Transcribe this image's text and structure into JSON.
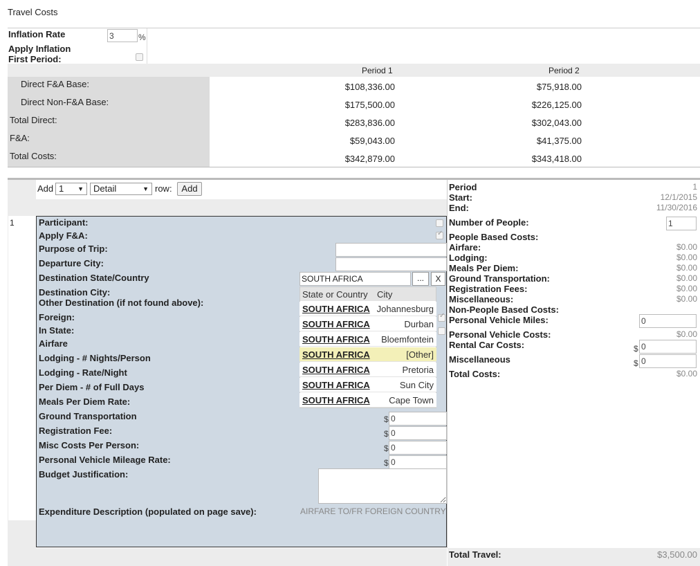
{
  "page_title": "Travel Costs",
  "inflation": {
    "rate_label": "Inflation Rate",
    "rate_value": "3",
    "percent": "%",
    "apply_label_line1": "Apply Inflation",
    "apply_label_line2": "First Period:"
  },
  "summary": {
    "period_headers": [
      "Period 1",
      "Period 2"
    ],
    "rows": [
      {
        "label": "Direct F&A Base:",
        "p1": "$108,336.00",
        "p2": "$75,918.00"
      },
      {
        "label": "Direct Non-F&A Base:",
        "p1": "$175,500.00",
        "p2": "$226,125.00"
      },
      {
        "label": "Total Direct:",
        "p1": "$283,836.00",
        "p2": "$302,043.00"
      },
      {
        "label": "F&A:",
        "p1": "$59,043.00",
        "p2": "$41,375.00"
      },
      {
        "label": "Total Costs:",
        "p1": "$342,879.00",
        "p2": "$343,418.00"
      }
    ]
  },
  "add_bar": {
    "add_label": "Add",
    "count_value": "1",
    "type_value": "Detail",
    "row_label": "row:",
    "add_button": "Add"
  },
  "row_number": "1",
  "form": {
    "participant": "Participant:",
    "apply_fa": "Apply F&A:",
    "purpose": "Purpose of Trip:",
    "departure_city": "Departure City:",
    "dest_state": "Destination State/Country",
    "dest_city": "Destination City:",
    "other_dest": "Other Destination (if not found above):",
    "foreign": "Foreign:",
    "in_state": "In State:",
    "airfare": "Airfare",
    "lodging_nights": "Lodging - # Nights/Person",
    "lodging_rate": "Lodging - Rate/Night",
    "per_diem_days": "Per Diem - # of Full Days",
    "meals_rate": "Meals Per Diem Rate:",
    "ground": "Ground Transportation",
    "registration": "Registration Fee:",
    "misc": "Misc Costs Per Person:",
    "mileage_rate": "Personal Vehicle Mileage Rate:",
    "justification": "Budget Justification:",
    "expenditure_label": "Expenditure Description (populated on page save):",
    "expenditure_value": "AIRFARE TO/FR FOREIGN COUNTRY",
    "dest_value": "SOUTH AFRICA",
    "lookup_button": "...",
    "clear_button": "X",
    "ground_value": "0",
    "registration_value": "0",
    "misc_value": "0",
    "mileage_value": "0",
    "dollar": "$"
  },
  "dropdown": {
    "headers": [
      "State or Country",
      "City"
    ],
    "rows": [
      {
        "country": "SOUTH AFRICA",
        "city": "Johannesburg"
      },
      {
        "country": "SOUTH AFRICA",
        "city": "Durban"
      },
      {
        "country": "SOUTH AFRICA",
        "city": "Bloemfontein"
      },
      {
        "country": "SOUTH AFRICA",
        "city": "[Other]",
        "highlighted": true
      },
      {
        "country": "SOUTH AFRICA",
        "city": "Pretoria"
      },
      {
        "country": "SOUTH AFRICA",
        "city": "Sun City"
      },
      {
        "country": "SOUTH AFRICA",
        "city": "Cape Town"
      }
    ],
    "highlight_color": "#f3f0b8"
  },
  "right_panel": {
    "period_label": "Period",
    "period_value": "1",
    "start_label": "Start:",
    "start_value": "12/1/2015",
    "end_label": "End:",
    "end_value": "11/30/2016",
    "num_people_label": "Number of People:",
    "num_people_value": "1",
    "people_costs_label": "People Based Costs:",
    "airfare_label": "Airfare:",
    "airfare_value": "$0.00",
    "lodging_label": "Lodging:",
    "lodging_value": "$0.00",
    "meals_label": "Meals Per Diem:",
    "meals_value": "$0.00",
    "ground_label": "Ground Transportation:",
    "ground_value": "$0.00",
    "registration_label": "Registration Fees:",
    "registration_value": "$0.00",
    "misc_label": "Miscellaneous:",
    "misc_value": "$0.00",
    "non_people_label": "Non-People Based Costs:",
    "vehicle_miles_label": "Personal Vehicle Miles:",
    "vehicle_miles_value": "0",
    "vehicle_costs_label": "Personal Vehicle Costs:",
    "vehicle_costs_value": "$0.00",
    "rental_label": "Rental Car Costs:",
    "rental_value": "0",
    "misc2_label": "Miscellaneous",
    "misc2_value": "0",
    "total_costs_label": "Total Costs:",
    "total_costs_value": "$0.00",
    "dollar": "$"
  },
  "total_travel": {
    "label": "Total Travel:",
    "value": "$3,500.00"
  },
  "colors": {
    "form_bg": "#cfd9e3",
    "gray_bg": "#ececec",
    "label_bg": "#dcdcdc"
  }
}
